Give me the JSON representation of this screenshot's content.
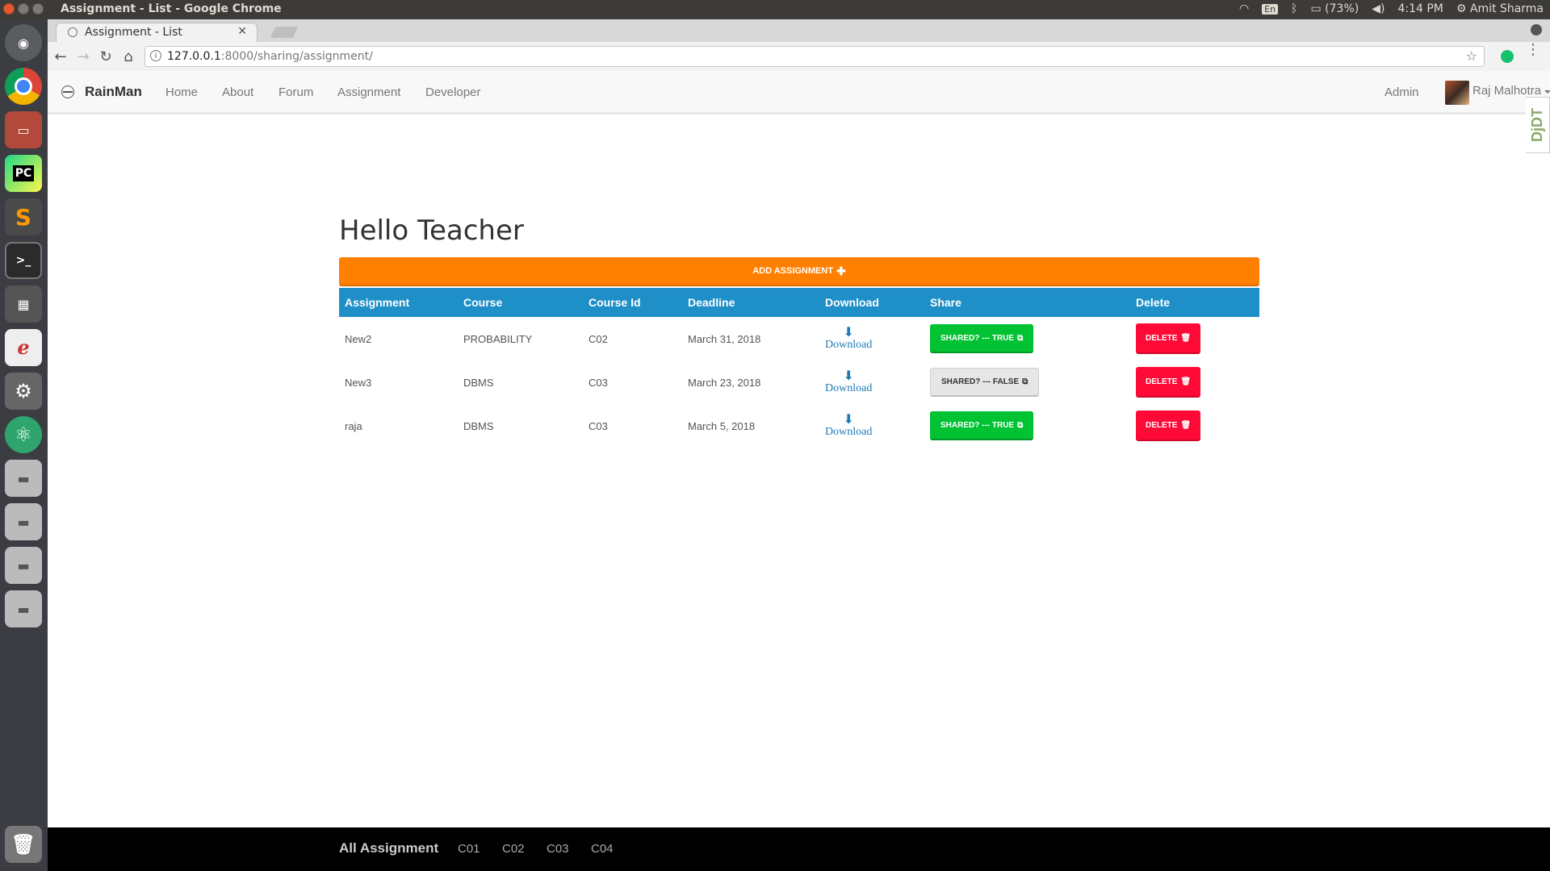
{
  "os": {
    "window_title": "Assignment - List - Google Chrome",
    "language": "En",
    "battery": "(73%)",
    "time": "4:14 PM",
    "user": "Amit Sharma",
    "launcher_icons": [
      "ubuntu-dash-icon",
      "chrome-icon",
      "files-icon",
      "pycharm-icon",
      "sublime-icon",
      "terminal-icon",
      "workspace-icon",
      "pdf-viewer-icon",
      "settings-icon",
      "atom-icon",
      "drive-icon",
      "drive-icon",
      "drive-icon",
      "drive-icon",
      "trash-icon"
    ]
  },
  "browser": {
    "tab_title": "Assignment - List",
    "url_host": "127.0.0.1",
    "url_path": ":8000/sharing/assignment/"
  },
  "site": {
    "brand": "RainMan",
    "nav": [
      "Home",
      "About",
      "Forum",
      "Assignment",
      "Developer"
    ],
    "admin": "Admin",
    "user_name": "Raj Malhotra",
    "toolbar_badge": "DjDT"
  },
  "page": {
    "greeting": "Hello Teacher",
    "add_button": "ADD ASSIGNMENT",
    "table": {
      "headers": [
        "Assignment",
        "Course",
        "Course Id",
        "Deadline",
        "Download",
        "Share",
        "Delete"
      ],
      "rows": [
        {
          "assignment": "New2",
          "course": "PROBABILITY",
          "course_id": "C02",
          "deadline": "March 31, 2018",
          "download": "Download",
          "share": "SHARED? --- TRUE",
          "shared": true,
          "delete": "DELETE"
        },
        {
          "assignment": "New3",
          "course": "DBMS",
          "course_id": "C03",
          "deadline": "March 23, 2018",
          "download": "Download",
          "share": "SHARED? --- FALSE",
          "shared": false,
          "delete": "DELETE"
        },
        {
          "assignment": "raja",
          "course": "DBMS",
          "course_id": "C03",
          "deadline": "March 5, 2018",
          "download": "Download",
          "share": "SHARED? --- TRUE",
          "shared": true,
          "delete": "DELETE"
        }
      ]
    }
  },
  "footer": {
    "brand": "All Assignment",
    "links": [
      "C01",
      "C02",
      "C03",
      "C04"
    ]
  },
  "colors": {
    "orange": "#ff7f00",
    "table_header": "#1f8fc8",
    "shared_true": "#00c233",
    "delete_red": "#ff0a36"
  }
}
